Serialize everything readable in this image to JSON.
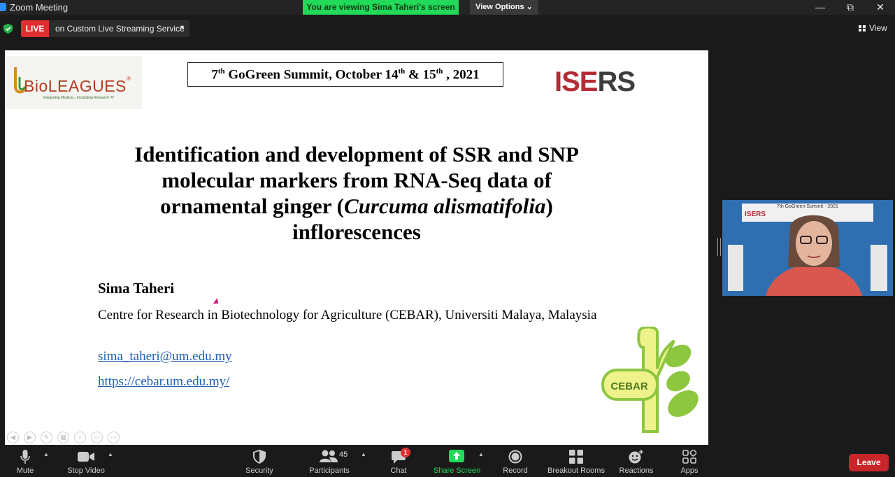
{
  "window": {
    "title": "Zoom Meeting",
    "viewing_banner": "You are viewing Sima Taheri's screen",
    "view_options": "View Options",
    "controls": {
      "minimize": "—",
      "restore": "⧉",
      "close": "✕"
    }
  },
  "status": {
    "live_label": "LIVE",
    "live_service": "on Custom Live Streaming Service",
    "view_label": "View"
  },
  "slide": {
    "bio_logo": {
      "name": "BioLEAGUES",
      "tagline": "Integrating Medicos...Incubating Research !!!!"
    },
    "summit": {
      "pre": "7",
      "th1": "th",
      "mid": " GoGreen Summit, October 14",
      "th2": "th",
      "mid2": "  & 15",
      "th3": "th",
      "post": " , 2021"
    },
    "iser_logo": {
      "part1": "ISE",
      "part2": "RS"
    },
    "title": {
      "line1": "Identification and development of SSR and SNP",
      "line2": "molecular markers from RNA-Seq data of",
      "line3_pre": "ornamental ginger (",
      "line3_italic": "Curcuma alismatifolia",
      "line3_post": ")",
      "line4": "inflorescences"
    },
    "author": "Sima Taheri",
    "affiliation": "Centre for Research in Biotechnology for Agriculture (CEBAR), Universiti Malaya, Malaysia",
    "email": "sima_taheri@um.edu.my",
    "website": "https://cebar.um.edu.my/",
    "cebar_logo": "CEBAR",
    "colors": {
      "link": "#1f5fb0",
      "iser_red": "#b52b35",
      "cebar_green": "#8dc63f"
    }
  },
  "video": {
    "banner_title": "7th GoGreen Summit - 2021",
    "banner_logo": "ISERS"
  },
  "toolbar": {
    "mute": "Mute",
    "stop_video": "Stop Video",
    "security": "Security",
    "participants": "Participants",
    "participants_count": "45",
    "chat": "Chat",
    "chat_badge": "1",
    "share_screen": "Share Screen",
    "record": "Record",
    "breakout_rooms": "Breakout Rooms",
    "reactions": "Reactions",
    "apps": "Apps",
    "leave": "Leave",
    "share_color": "#23d959"
  }
}
